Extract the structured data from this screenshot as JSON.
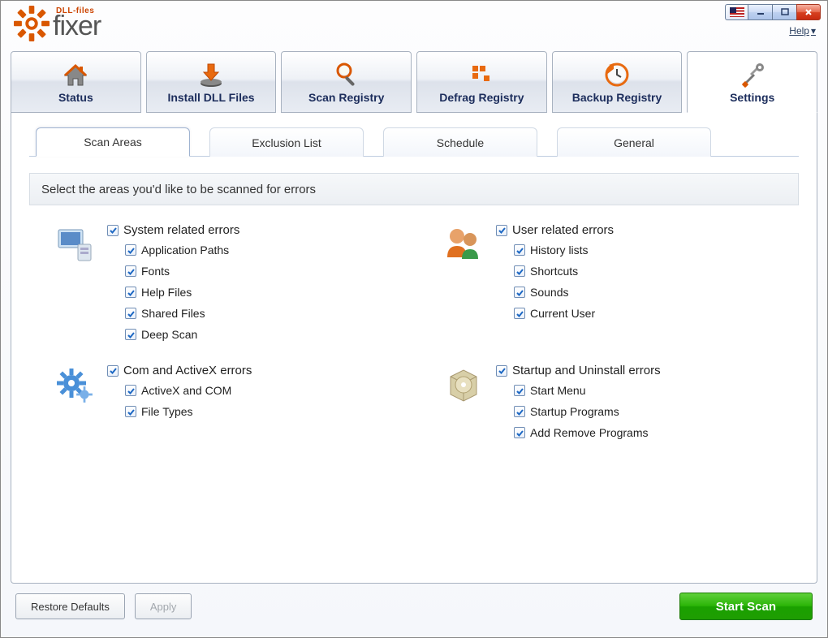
{
  "titlebar": {
    "help_label": "Help"
  },
  "logo": {
    "supertitle": "DLL-files",
    "title": "fixer"
  },
  "nav": {
    "status": "Status",
    "install_dll": "Install DLL Files",
    "scan_registry": "Scan Registry",
    "defrag_registry": "Defrag Registry",
    "backup_registry": "Backup Registry",
    "settings": "Settings"
  },
  "subtabs": {
    "scan_areas": "Scan Areas",
    "exclusion_list": "Exclusion List",
    "schedule": "Schedule",
    "general": "General"
  },
  "instruction": "Select the areas you'd like to be scanned for errors",
  "groups": {
    "system": {
      "title": "System related errors",
      "items": [
        "Application Paths",
        "Fonts",
        "Help Files",
        "Shared Files",
        "Deep Scan"
      ]
    },
    "user": {
      "title": "User related errors",
      "items": [
        "History lists",
        "Shortcuts",
        "Sounds",
        "Current User"
      ]
    },
    "com": {
      "title": "Com and ActiveX errors",
      "items": [
        "ActiveX and COM",
        "File Types"
      ]
    },
    "startup": {
      "title": "Startup and Uninstall errors",
      "items": [
        "Start Menu",
        "Startup Programs",
        "Add Remove Programs"
      ]
    }
  },
  "footer": {
    "restore": "Restore Defaults",
    "apply": "Apply",
    "start_scan": "Start Scan"
  }
}
